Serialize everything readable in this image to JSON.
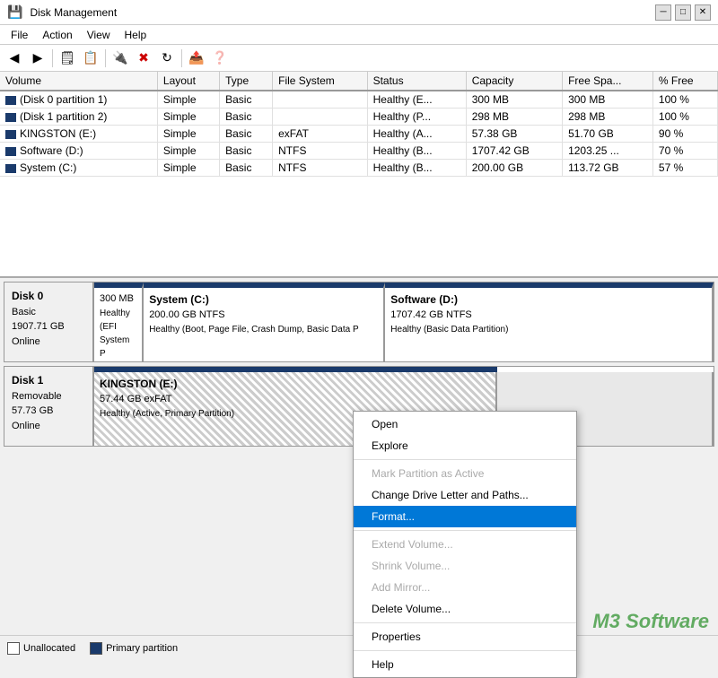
{
  "title_bar": {
    "title": "Disk Management",
    "icon": "💾"
  },
  "menu": {
    "items": [
      "File",
      "Action",
      "View",
      "Help"
    ]
  },
  "toolbar": {
    "buttons": [
      {
        "name": "back",
        "icon": "←"
      },
      {
        "name": "forward",
        "icon": "→"
      },
      {
        "name": "up",
        "icon": "⬆"
      },
      {
        "name": "properties",
        "icon": "🗒"
      },
      {
        "name": "properties2",
        "icon": "📋"
      },
      {
        "name": "connect",
        "icon": "🔌"
      },
      {
        "name": "delete",
        "icon": "✖",
        "red": true
      },
      {
        "name": "refresh",
        "icon": "↻"
      },
      {
        "name": "export",
        "icon": "📤"
      },
      {
        "name": "help",
        "icon": "❓"
      }
    ]
  },
  "table": {
    "headers": [
      "Volume",
      "Layout",
      "Type",
      "File System",
      "Status",
      "Capacity",
      "Free Spa...",
      "% Free"
    ],
    "rows": [
      {
        "volume": "(Disk 0 partition 1)",
        "layout": "Simple",
        "type": "Basic",
        "fs": "",
        "status": "Healthy (E...",
        "capacity": "300 MB",
        "free": "300 MB",
        "pct": "100 %"
      },
      {
        "volume": "(Disk 1 partition 2)",
        "layout": "Simple",
        "type": "Basic",
        "fs": "",
        "status": "Healthy (P...",
        "capacity": "298 MB",
        "free": "298 MB",
        "pct": "100 %"
      },
      {
        "volume": "KINGSTON (E:)",
        "layout": "Simple",
        "type": "Basic",
        "fs": "exFAT",
        "status": "Healthy (A...",
        "capacity": "57.38 GB",
        "free": "51.70 GB",
        "pct": "90 %"
      },
      {
        "volume": "Software (D:)",
        "layout": "Simple",
        "type": "Basic",
        "fs": "NTFS",
        "status": "Healthy (B...",
        "capacity": "1707.42 GB",
        "free": "1203.25 ...",
        "pct": "70 %"
      },
      {
        "volume": "System (C:)",
        "layout": "Simple",
        "type": "Basic",
        "fs": "NTFS",
        "status": "Healthy (B...",
        "capacity": "200.00 GB",
        "free": "113.72 GB",
        "pct": "57 %"
      }
    ]
  },
  "disks": {
    "disk0": {
      "label": "Disk 0",
      "type": "Basic",
      "size": "1907.71 GB",
      "status": "Online",
      "partitions": [
        {
          "label": "300 MB",
          "sub": "Healthy (EFI System P",
          "width": "5%",
          "type": "plain"
        },
        {
          "label": "System (C:)",
          "sub1": "200.00 GB NTFS",
          "sub2": "Healthy (Boot, Page File, Crash Dump, Basic Data P",
          "width": "45%",
          "type": "blue"
        },
        {
          "label": "Software (D:)",
          "sub1": "1707.42 GB NTFS",
          "sub2": "Healthy (Basic Data Partition)",
          "width": "50%",
          "type": "blue"
        }
      ]
    },
    "disk1": {
      "label": "Disk 1",
      "type": "Removable",
      "size": "57.73 GB",
      "status": "Online",
      "partitions": [
        {
          "label": "KINGSTON (E:)",
          "sub1": "57.44 GB exFAT",
          "sub2": "Healthy (Active, Primary Partition)",
          "width": "65%",
          "type": "hatched"
        },
        {
          "label": "",
          "sub1": "",
          "sub2": "",
          "width": "35%",
          "type": "plain-selected"
        }
      ]
    }
  },
  "context_menu": {
    "items": [
      {
        "label": "Open",
        "enabled": true
      },
      {
        "label": "Explore",
        "enabled": true
      },
      {
        "label": "separator"
      },
      {
        "label": "Mark Partition as Active",
        "enabled": false
      },
      {
        "label": "Change Drive Letter and Paths...",
        "enabled": true
      },
      {
        "label": "Format...",
        "enabled": true,
        "active": true
      },
      {
        "label": "separator"
      },
      {
        "label": "Extend Volume...",
        "enabled": false
      },
      {
        "label": "Shrink Volume...",
        "enabled": false
      },
      {
        "label": "Add Mirror...",
        "enabled": false
      },
      {
        "label": "Delete Volume...",
        "enabled": true
      },
      {
        "label": "separator"
      },
      {
        "label": "Properties",
        "enabled": true
      },
      {
        "label": "separator"
      },
      {
        "label": "Help",
        "enabled": true
      }
    ]
  },
  "legend": {
    "items": [
      {
        "label": "Unallocated",
        "color": "white"
      },
      {
        "label": "Primary partition",
        "color": "blue"
      }
    ]
  },
  "watermark": {
    "text": "M3 Software"
  }
}
